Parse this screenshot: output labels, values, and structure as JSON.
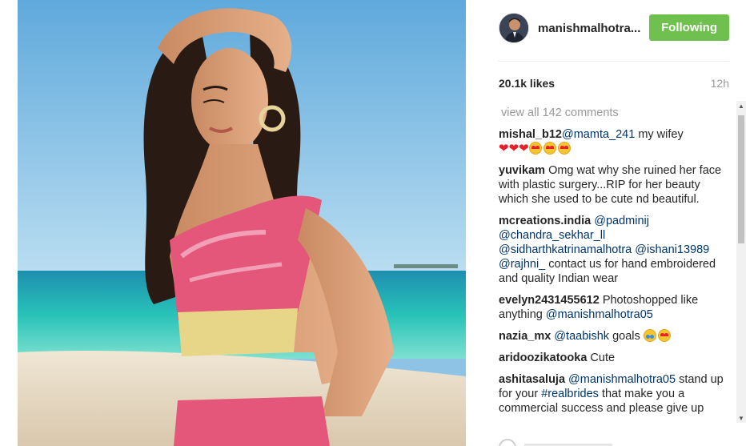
{
  "post": {
    "photo_description_icon": "photo",
    "author": "manishmalhotra...",
    "follow_label": "Following",
    "likes": "20.1k likes",
    "time": "12h",
    "view_all": "view all 142 comments"
  },
  "comments": [
    {
      "user": "mishal_b12",
      "parts": [
        {
          "t": "mention",
          "v": "@mamta_241"
        },
        {
          "t": "text",
          "v": " my wifey"
        }
      ],
      "emoji": [
        "heart",
        "heart",
        "heart",
        "heart-eyes",
        "heart-eyes",
        "heart-eyes"
      ]
    },
    {
      "user": "yuvikam",
      "parts": [
        {
          "t": "text",
          "v": " Omg wat why she ruined her face with plastic surgery...RIP for her beauty which she used to be cute nd beautiful."
        }
      ],
      "emoji": []
    },
    {
      "user": "mcreations.india",
      "parts": [
        {
          "t": "text",
          "v": " "
        },
        {
          "t": "mention",
          "v": "@padminij"
        },
        {
          "t": "text",
          "v": " "
        },
        {
          "t": "mention",
          "v": "@chandra_sekhar_ll"
        },
        {
          "t": "text",
          "v": " "
        },
        {
          "t": "mention",
          "v": "@sidharthkatrinamalhotra"
        },
        {
          "t": "text",
          "v": " "
        },
        {
          "t": "mention",
          "v": "@ishani13989"
        },
        {
          "t": "text",
          "v": " "
        },
        {
          "t": "mention",
          "v": "@rajhni_"
        },
        {
          "t": "text",
          "v": " contact us for hand embroidered and quality Indian wear"
        }
      ],
      "emoji": []
    },
    {
      "user": "evelyn2431455612",
      "parts": [
        {
          "t": "text",
          "v": " Photoshopped like anything "
        },
        {
          "t": "mention",
          "v": "@manishmalhotra05"
        }
      ],
      "emoji": []
    },
    {
      "user": "nazia_mx",
      "parts": [
        {
          "t": "text",
          "v": " "
        },
        {
          "t": "mention",
          "v": "@taabishk"
        },
        {
          "t": "text",
          "v": " goals "
        }
      ],
      "emoji": [
        "crying",
        "heart-eyes"
      ]
    },
    {
      "user": "aridoozikatooka",
      "parts": [
        {
          "t": "text",
          "v": " Cute"
        }
      ],
      "emoji": []
    },
    {
      "user": "ashitasaluja",
      "parts": [
        {
          "t": "text",
          "v": " "
        },
        {
          "t": "mention",
          "v": "@manishmalhotra05"
        },
        {
          "t": "text",
          "v": " stand up for your "
        },
        {
          "t": "tag",
          "v": "#realbrides"
        },
        {
          "t": "text",
          "v": " that make you a commercial success and please give up"
        }
      ],
      "emoji": []
    }
  ],
  "icons": {
    "avatar": "avatar-icon",
    "scroll_up": "scroll-up-arrow-icon",
    "scroll_down": "scroll-down-arrow-icon",
    "like": "heart-outline-icon"
  },
  "colors": {
    "follow_button": "#70c050",
    "link": "#003569",
    "muted": "#999999",
    "text": "#262626"
  }
}
